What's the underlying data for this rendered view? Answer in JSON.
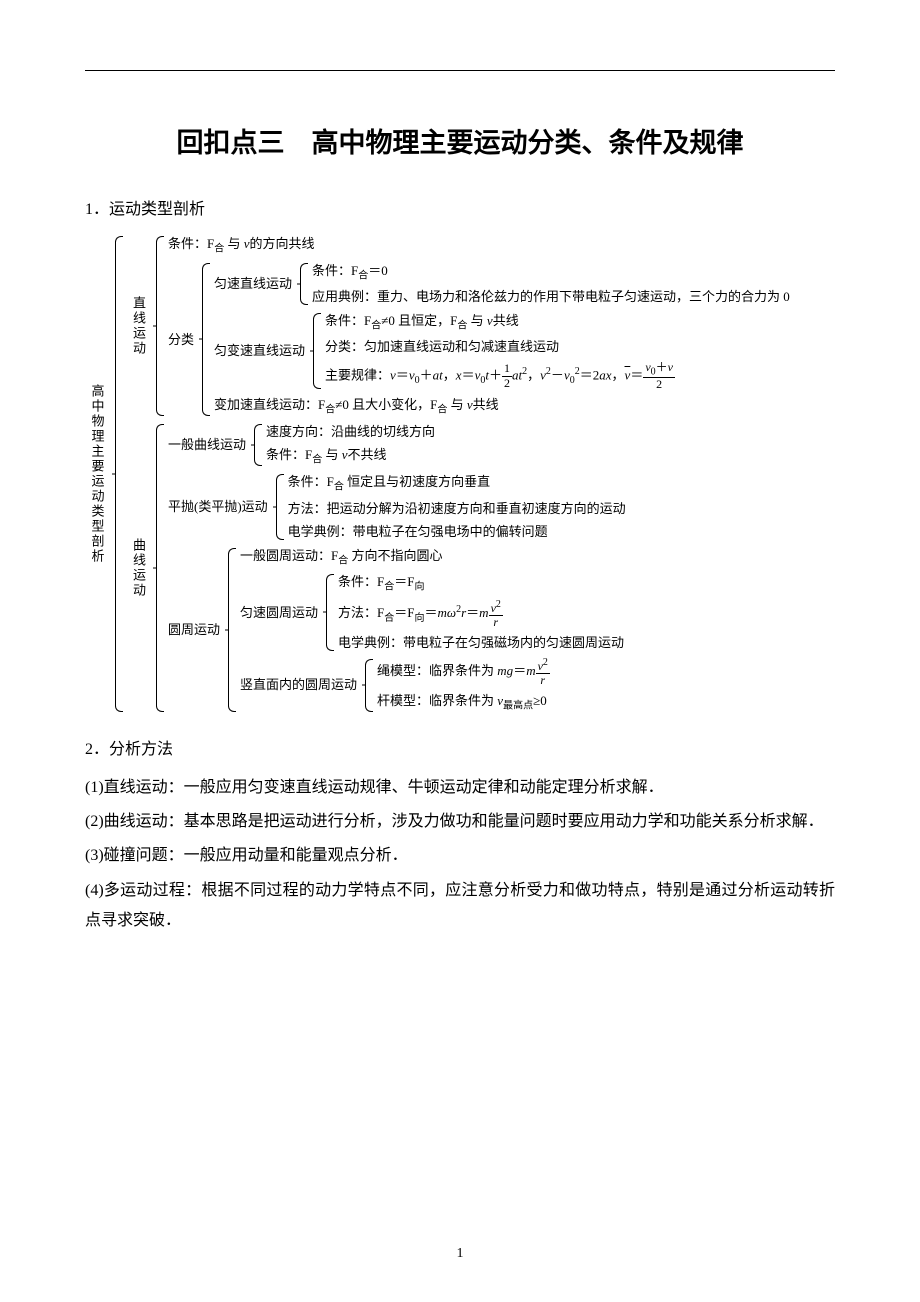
{
  "title": "回扣点三　高中物理主要运动分类、条件及规律",
  "sec1": {
    "heading": "1．运动类型剖析"
  },
  "tree": {
    "root": "高中物理主要运动类型剖析",
    "linear": {
      "label": "直线运动",
      "cond": "条件：F₍合₎ 与 v的方向共线",
      "cls": "分类",
      "uniform": {
        "label": "匀速直线运动",
        "c": "条件：F₍合₎＝0",
        "ex": "应用典例：重力、电场力和洛伦兹力的作用下带电粒子匀速运动，三个力的合力为 0"
      },
      "uacc": {
        "label": "匀变速直线运动",
        "c": "条件：F₍合₎≠0 且恒定，F₍合₎ 与 v共线",
        "cls": "分类：匀加速直线运动和匀减速直线运动",
        "law_prefix": "主要规律："
      },
      "vacc": "变加速直线运动：F₍合₎≠0 且大小变化，F₍合₎ 与 v共线"
    },
    "curve": {
      "label": "曲线运动",
      "gen": {
        "label": "一般曲线运动",
        "a": "速度方向：沿曲线的切线方向",
        "b": "条件：F₍合₎ 与 v不共线"
      },
      "proj": {
        "label": "平抛(类平抛)运动",
        "a": "条件：F₍合₎ 恒定且与初速度方向垂直",
        "b": "方法：把运动分解为沿初速度方向和垂直初速度方向的运动",
        "c": "电学典例：带电粒子在匀强电场中的偏转问题"
      },
      "circ": {
        "label": "圆周运动",
        "gen": "一般圆周运动：F₍合₎ 方向不指向圆心",
        "uni": {
          "label": "匀速圆周运动",
          "a": "条件：F₍合₎＝F₍向₎",
          "b_prefix": "方法：F₍合₎＝F₍向₎＝",
          "c": "电学典例：带电粒子在匀强磁场内的匀速圆周运动"
        },
        "vert": {
          "label": "竖直面内的圆周运动",
          "rope_prefix": "绳模型：临界条件为 ",
          "rod": "杆模型：临界条件为 v₍最高点₎≥0"
        }
      }
    }
  },
  "sec2": {
    "heading": "2．分析方法",
    "p1": "(1)直线运动：一般应用匀变速直线运动规律、牛顿运动定律和动能定理分析求解．",
    "p2": "(2)曲线运动：基本思路是把运动进行分析，涉及力做功和能量问题时要应用动力学和功能关系分析求解．",
    "p3": "(3)碰撞问题：一般应用动量和能量观点分析．",
    "p4": "(4)多运动过程：根据不同过程的动力学特点不同，应注意分析受力和做功特点，特别是通过分析运动转折点寻求突破．"
  },
  "pageNumber": "1"
}
